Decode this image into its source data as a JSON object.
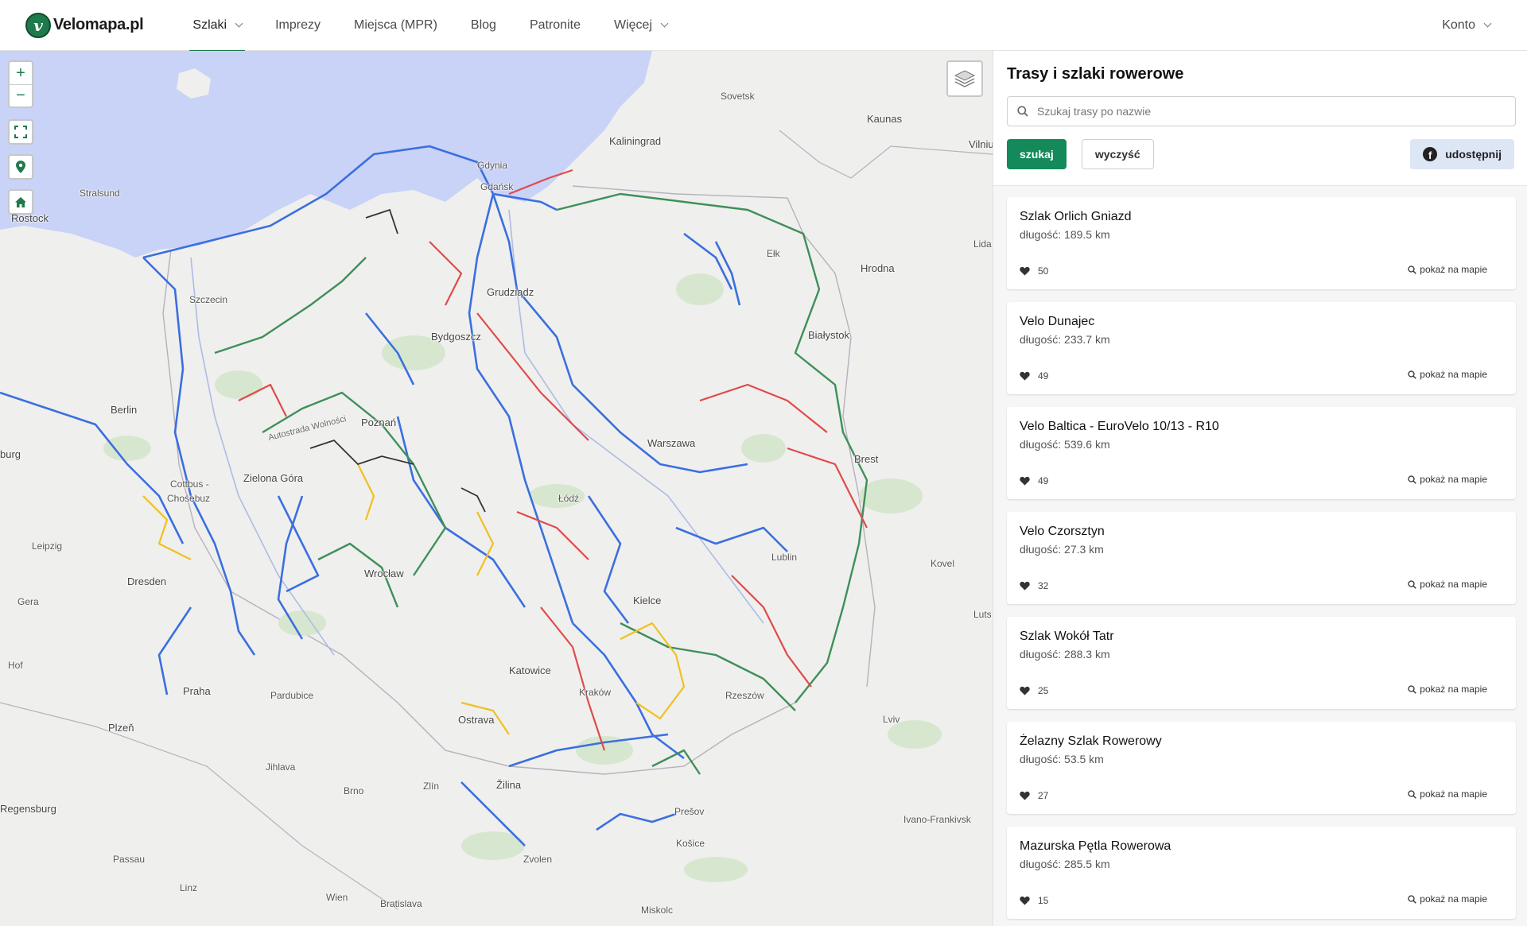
{
  "brand": {
    "logo_letter": "v",
    "name": "Velomapa.pl"
  },
  "nav": {
    "items": [
      {
        "label": "Szlaki",
        "dropdown": true,
        "active": true
      },
      {
        "label": "Imprezy"
      },
      {
        "label": "Miejsca (MPR)"
      },
      {
        "label": "Blog"
      },
      {
        "label": "Patronite"
      },
      {
        "label": "Więcej",
        "dropdown": true
      }
    ],
    "account": "Konto"
  },
  "map": {
    "controls": {
      "zoom_in": "+",
      "zoom_out": "−"
    },
    "labels": {
      "sovetsk": "Sovetsk",
      "kaunas": "Kaunas",
      "vilnius": "Vilniu",
      "kaliningrad": "Kaliningrad",
      "gdynia": "Gdynia",
      "gdansk": "Gdańsk",
      "stralsund": "Stralsund",
      "rostock": "Rostock",
      "elk": "Ełk",
      "hrodna": "Hrodna",
      "lida": "Lida",
      "grudziadz": "Grudziądz",
      "szczecin": "Szczecin",
      "bydgoszcz": "Bydgoszcz",
      "bialystok": "Białystok",
      "berlin": "Berlin",
      "autostrada": "Autostrada Wolności",
      "poznan": "Poznań",
      "warszawa": "Warszawa",
      "brest": "Brest",
      "burg": "burg",
      "cottbus": "Cottbus -",
      "chosebuz": "Chośebuz",
      "zielona_gora": "Zielona Góra",
      "leipzig": "Leipzig",
      "lodz": "Łódź",
      "lublin": "Lublin",
      "kovel": "Kovel",
      "dresden": "Dresden",
      "wroclaw": "Wrocław",
      "gera": "Gera",
      "kielce": "Kielce",
      "lutsk": "Luts",
      "hof": "Hof",
      "katowice": "Katowice",
      "praha": "Praha",
      "pardubice": "Pardubice",
      "krakow": "Kraków",
      "rzeszow": "Rzeszów",
      "plzen": "Plzeň",
      "ostrava": "Ostrava",
      "lviv": "Lviv",
      "jihlava": "Jihlava",
      "zlin": "Zlín",
      "brno": "Brno",
      "zilina": "Žilina",
      "presov": "Prešov",
      "regensburg": "Regensburg",
      "ivano": "Ivano-Frankivsk",
      "kosice": "Košice",
      "passau": "Passau",
      "zvolen": "Zvolen",
      "linz": "Linz",
      "wien": "Wien",
      "bratislava": "Bratislava",
      "miskolc": "Miskolc"
    },
    "colors": {
      "water": "#c9d2f7",
      "land": "#efefed",
      "blue_route": "#3b6fe0",
      "green_route": "#3f8f5a",
      "red_route": "#e04a4a",
      "yellow_route": "#f0c020"
    }
  },
  "sidebar": {
    "title": "Trasy i szlaki rowerowe",
    "search_placeholder": "Szukaj trasy po nazwie",
    "search_button": "szukaj",
    "clear_button": "wyczyść",
    "share_button": "udostępnij",
    "show_on_map": "pokaż na mapie",
    "routes": [
      {
        "name": "Szlak Orlich Gniazd",
        "length": "długość: 189.5 km",
        "likes": "50"
      },
      {
        "name": "Velo Dunajec",
        "length": "długość: 233.7 km",
        "likes": "49"
      },
      {
        "name": "Velo Baltica - EuroVelo 10/13 - R10",
        "length": "długość: 539.6 km",
        "likes": "49"
      },
      {
        "name": "Velo Czorsztyn",
        "length": "długość: 27.3 km",
        "likes": "32"
      },
      {
        "name": "Szlak Wokół Tatr",
        "length": "długość: 288.3 km",
        "likes": "25"
      },
      {
        "name": "Żelazny Szlak Rowerowy",
        "length": "długość: 53.5 km",
        "likes": "27"
      },
      {
        "name": "Mazurska Pętla Rowerowa",
        "length": "długość: 285.5 km",
        "likes": "15"
      }
    ]
  }
}
